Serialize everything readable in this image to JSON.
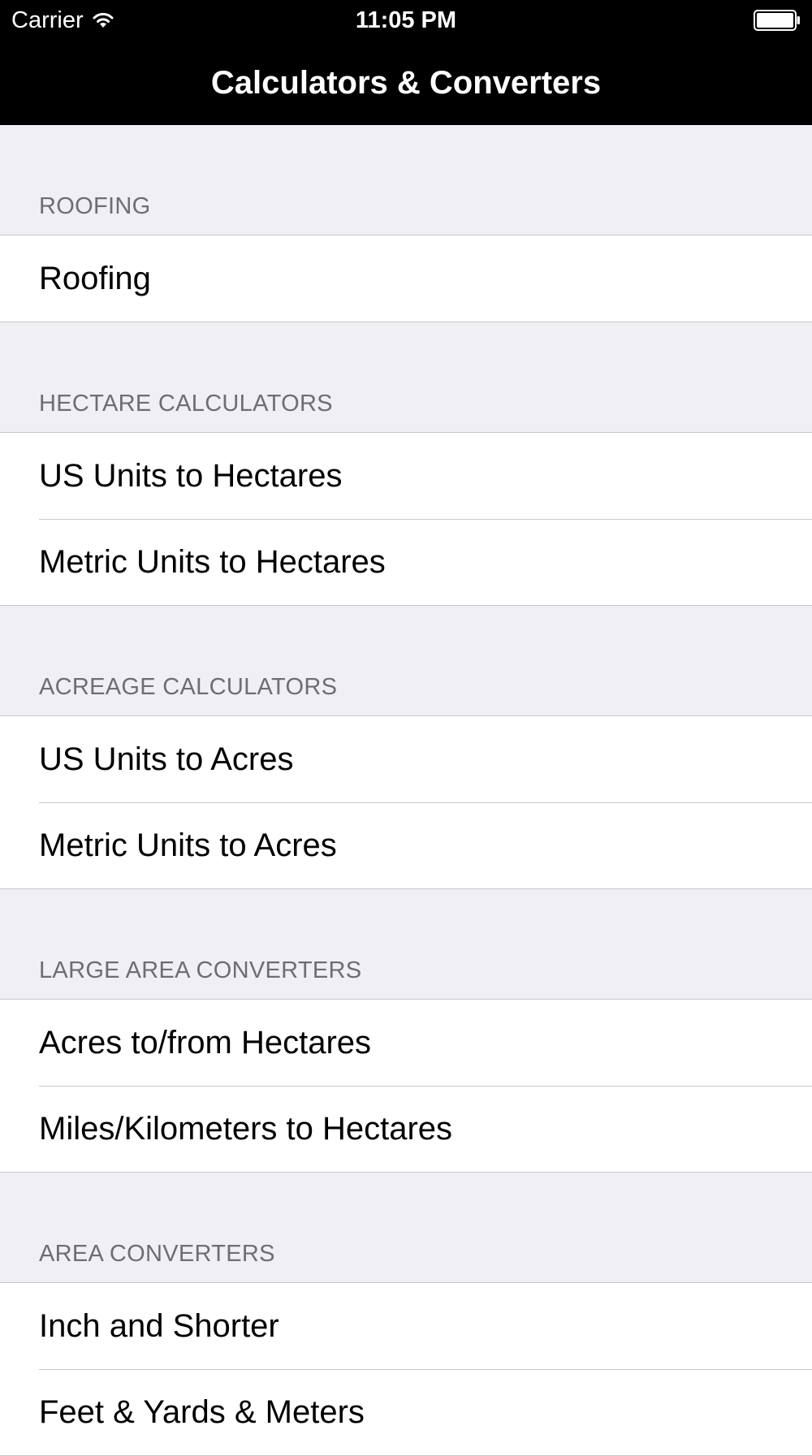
{
  "status_bar": {
    "carrier": "Carrier",
    "time": "11:05 PM"
  },
  "nav": {
    "title": "Calculators & Converters"
  },
  "sections": [
    {
      "header": "ROOFING",
      "items": [
        {
          "label": "Roofing"
        }
      ]
    },
    {
      "header": "HECTARE CALCULATORS",
      "items": [
        {
          "label": "US Units to Hectares"
        },
        {
          "label": "Metric Units to Hectares"
        }
      ]
    },
    {
      "header": "ACREAGE CALCULATORS",
      "items": [
        {
          "label": "US Units to Acres"
        },
        {
          "label": "Metric Units to Acres"
        }
      ]
    },
    {
      "header": "LARGE AREA CONVERTERS",
      "items": [
        {
          "label": "Acres to/from Hectares"
        },
        {
          "label": "Miles/Kilometers to Hectares"
        }
      ]
    },
    {
      "header": "AREA CONVERTERS",
      "items": [
        {
          "label": "Inch and Shorter"
        },
        {
          "label": "Feet & Yards & Meters"
        }
      ]
    }
  ],
  "icons": {
    "wifi": "wifi-icon",
    "battery": "battery-icon"
  },
  "colors": {
    "nav_background": "#000000",
    "nav_text": "#ffffff",
    "grouped_background": "#efeff4",
    "section_header_text": "#6d6d72",
    "separator": "#c8c7cc"
  }
}
